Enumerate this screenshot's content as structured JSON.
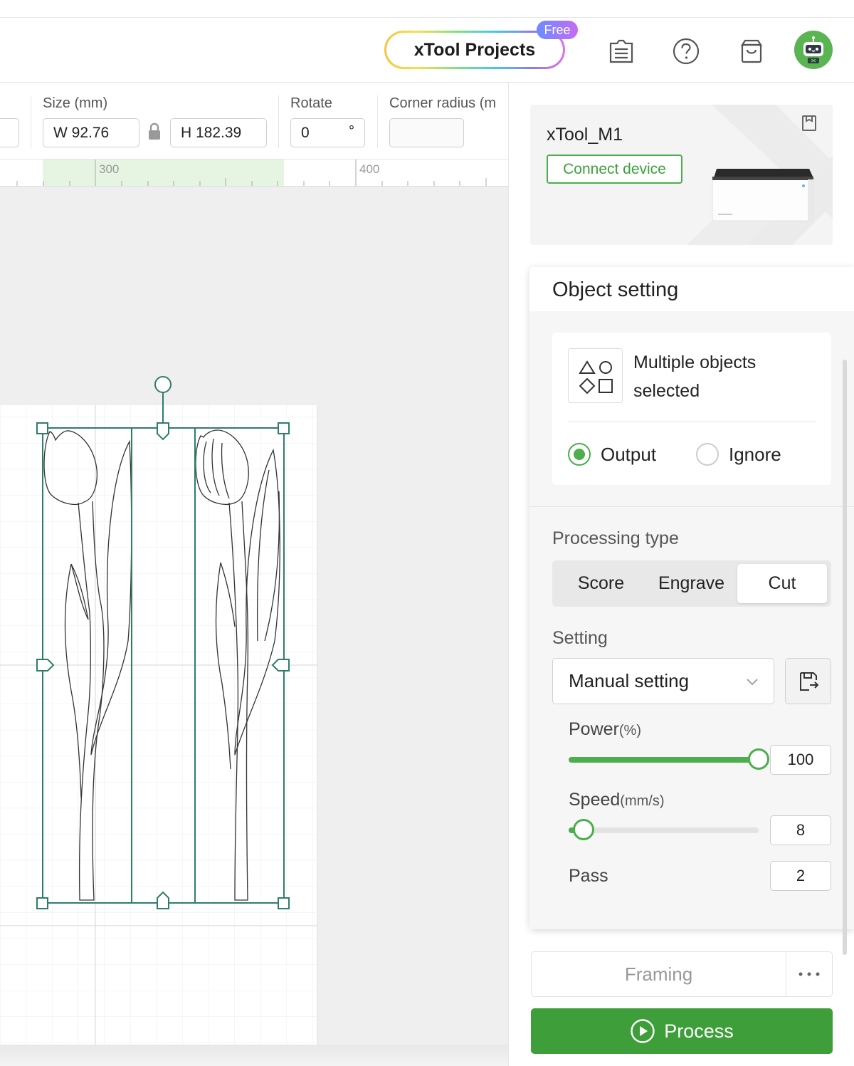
{
  "header": {
    "projects_label": "xTool Projects",
    "free_badge": "Free",
    "icons": [
      "notes-icon",
      "help-icon",
      "shop-icon",
      "robot-avatar-icon"
    ]
  },
  "toolbar": {
    "size_label": "Size (mm)",
    "width_value": "W 92.76",
    "height_value": "H 182.39",
    "rotate_label": "Rotate",
    "rotate_value": "0",
    "rotate_unit": "°",
    "corner_label": "Corner radius (m",
    "corner_value": ""
  },
  "ruler": {
    "ticks": [
      "300",
      "400"
    ]
  },
  "device": {
    "name": "xTool_M1",
    "connect_label": "Connect device"
  },
  "object_setting": {
    "title": "Object setting",
    "selection_text": "Multiple objects selected",
    "output_label": "Output",
    "ignore_label": "Ignore",
    "selected_mode": "Output",
    "processing_type_label": "Processing type",
    "processing_types": [
      "Score",
      "Engrave",
      "Cut"
    ],
    "active_processing_type": "Cut",
    "setting_label": "Setting",
    "setting_value": "Manual setting",
    "power_label": "Power",
    "power_unit": "(%)",
    "power_value": "100",
    "power_fraction": 1.0,
    "speed_label": "Speed",
    "speed_unit": "(mm/s)",
    "speed_value": "8",
    "speed_fraction": 0.08,
    "pass_label": "Pass",
    "pass_value": "2"
  },
  "actions": {
    "framing_label": "Framing",
    "more_label": "···",
    "process_label": "Process"
  },
  "colors": {
    "accent": "#4cae4c",
    "process_button": "#3d9e3a",
    "selection_frame": "#2e7d6b"
  }
}
